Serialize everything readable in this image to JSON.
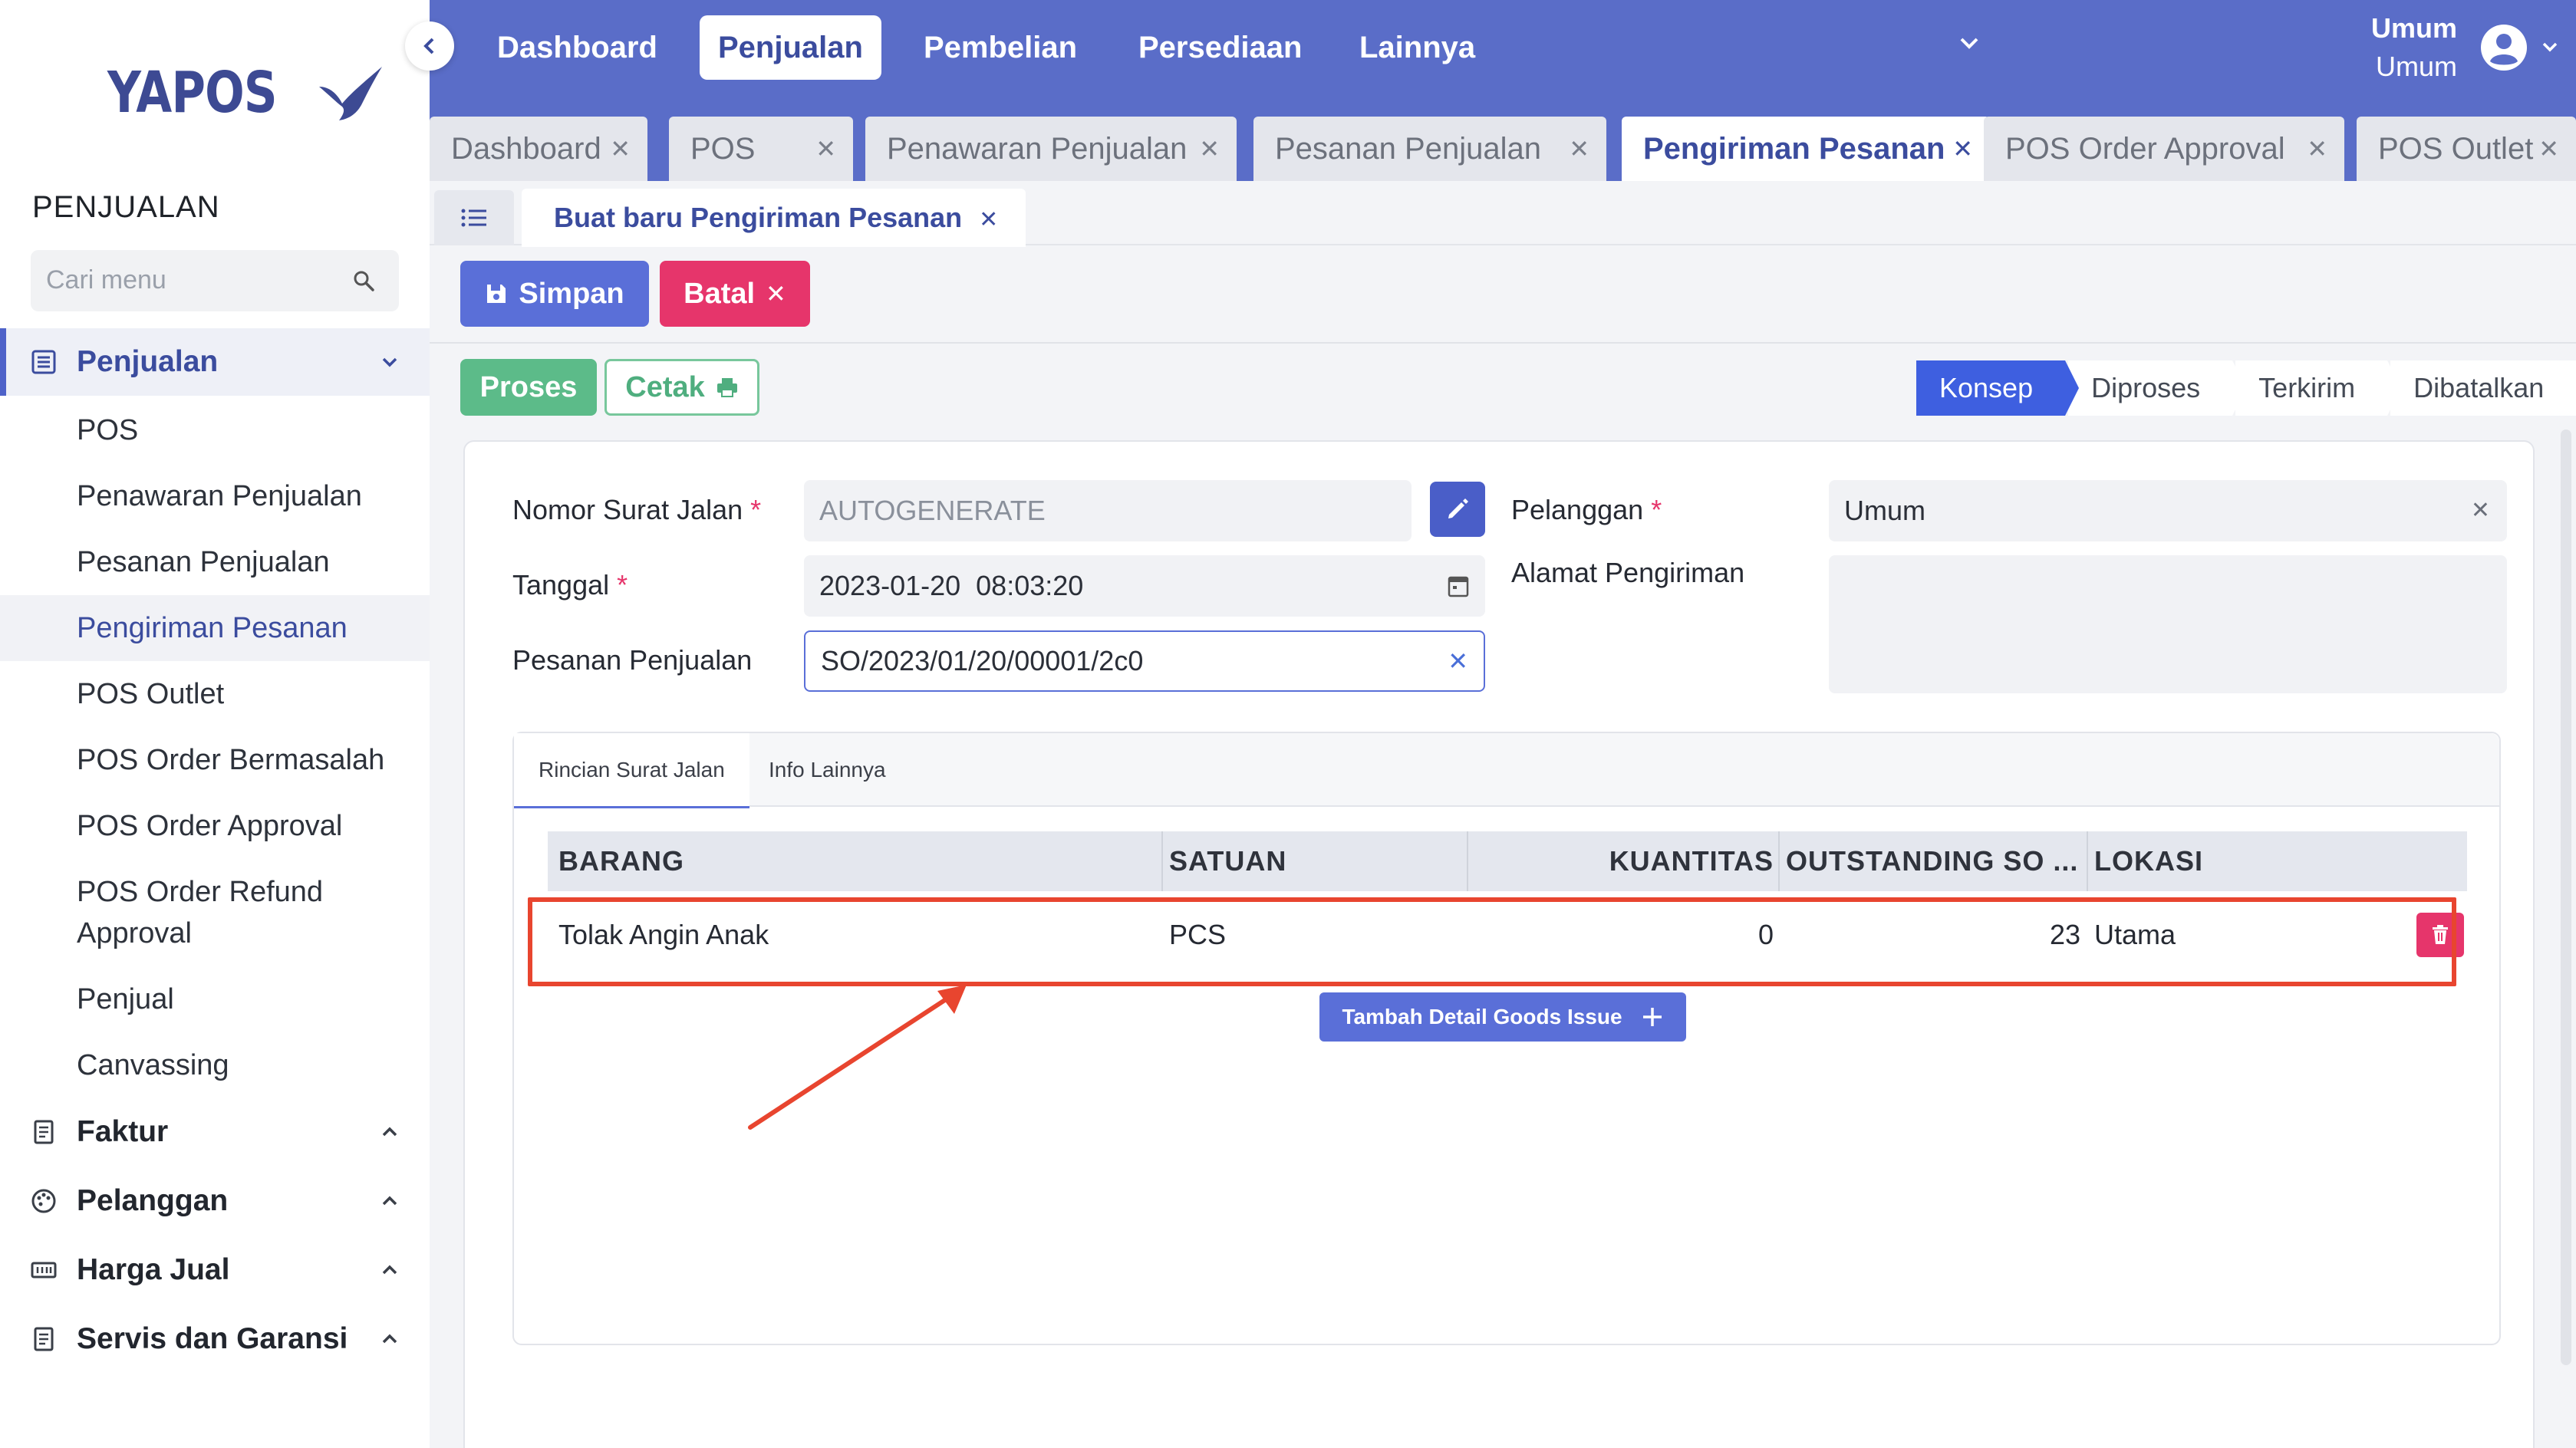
{
  "brand": {
    "name": "YAPOS"
  },
  "sidebar": {
    "section_title": "PENJUALAN",
    "search_placeholder": "Cari menu",
    "groups": [
      {
        "label": "Penjualan",
        "icon": "list-icon",
        "expanded": true
      },
      {
        "label": "Faktur",
        "icon": "receipt-icon",
        "expanded": false
      },
      {
        "label": "Pelanggan",
        "icon": "palette-icon",
        "expanded": false
      },
      {
        "label": "Harga Jual",
        "icon": "price-tag-icon",
        "expanded": false
      },
      {
        "label": "Servis dan Garansi",
        "icon": "receipt-icon",
        "expanded": false
      }
    ],
    "items": [
      "POS",
      "Penawaran Penjualan",
      "Pesanan Penjualan",
      "Pengiriman Pesanan",
      "POS Outlet",
      "POS Order Bermasalah",
      "POS Order Approval",
      "POS Order Refund",
      "Approval",
      "Penjual",
      "Canvassing"
    ],
    "current_item": "Pengiriman Pesanan"
  },
  "topnav": {
    "items": [
      "Dashboard",
      "Penjualan",
      "Pembelian",
      "Persediaan",
      "Lainnya"
    ],
    "active": "Penjualan",
    "user_line1": "Umum",
    "user_line2": "Umum"
  },
  "tabs": [
    "Dashboard",
    "POS",
    "Penawaran Penjualan",
    "Pesanan Penjualan",
    "Pengiriman Pesanan",
    "POS Order Approval",
    "POS Outlet"
  ],
  "active_tab": "Pengiriman Pesanan",
  "document_tab": "Buat baru Pengiriman Pesanan",
  "toolbar": {
    "save": "Simpan",
    "cancel": "Batal",
    "process": "Proses",
    "print": "Cetak"
  },
  "status_steps": [
    "Konsep",
    "Diproses",
    "Terkirim",
    "Dibatalkan"
  ],
  "active_status": "Konsep",
  "form": {
    "nomor_label": "Nomor Surat Jalan",
    "nomor_value": "AUTOGENERATE",
    "tanggal_label": "Tanggal",
    "tanggal_value": "2023-01-20  08:03:20",
    "pesanan_label": "Pesanan Penjualan",
    "pesanan_value": "SO/2023/01/20/00001/2c0",
    "pelanggan_label": "Pelanggan",
    "pelanggan_value": "Umum",
    "alamat_label": "Alamat Pengiriman",
    "alamat_value": ""
  },
  "detail_tabs": [
    "Rincian Surat Jalan",
    "Info Lainnya"
  ],
  "table": {
    "columns": [
      "BARANG",
      "SATUAN",
      "KUANTITAS",
      "OUTSTANDING SO ...",
      "LOKASI"
    ],
    "rows": [
      {
        "barang": "Tolak Angin Anak",
        "satuan": "PCS",
        "kuantitas": "0",
        "outstanding": "23",
        "lokasi": "Utama"
      }
    ]
  },
  "add_detail_label": "Tambah Detail Goods Issue",
  "colors": {
    "primary": "#5a6dc8",
    "accent": "#3b4c9e",
    "danger": "#e6356b",
    "success": "#5cbb89",
    "annotation": "#e8452f"
  }
}
